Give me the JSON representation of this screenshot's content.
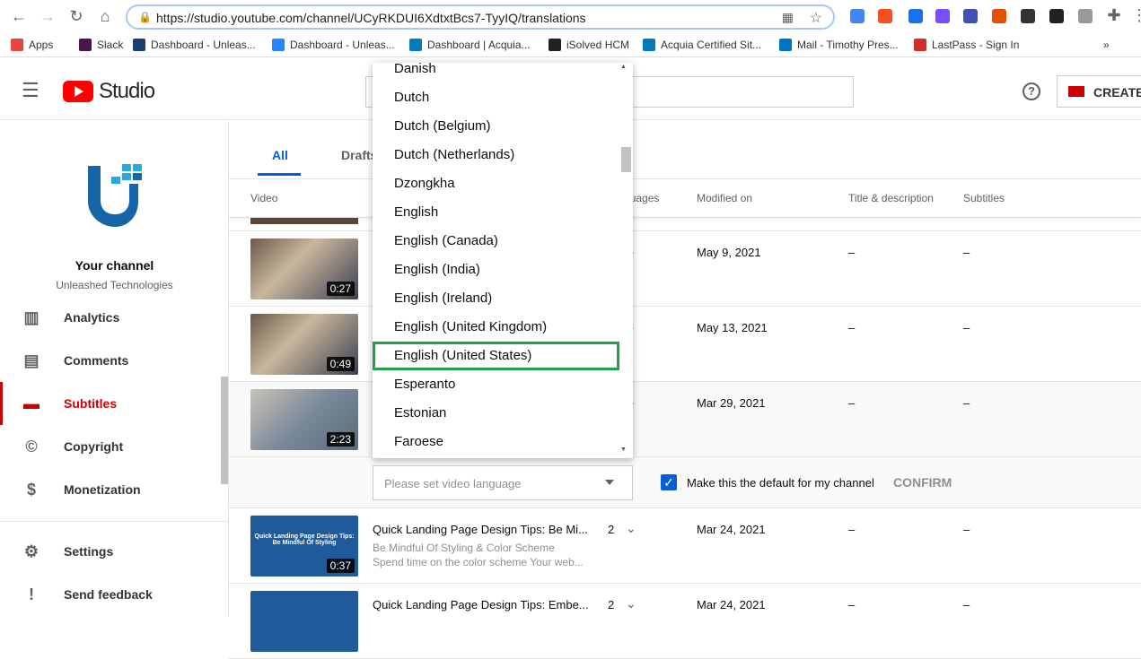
{
  "browser": {
    "url": "https://studio.youtube.com/channel/UCyRKDUI6XdtxtBcs7-TyyIQ/translations",
    "bookmarks": [
      {
        "label": "Apps",
        "color": "#e8453c"
      },
      {
        "label": "Slack",
        "color": "#4a154b"
      },
      {
        "label": "Dashboard - Unleas...",
        "color": "#1b3e6f"
      },
      {
        "label": "Dashboard - Unleas...",
        "color": "#2684ff"
      },
      {
        "label": "Dashboard | Acquia...",
        "color": "#0678be"
      },
      {
        "label": "iSolved HCM",
        "color": "#222"
      },
      {
        "label": "Acquia Certified Sit...",
        "color": "#0678be"
      },
      {
        "label": "Mail - Timothy Pres...",
        "color": "#0072c6"
      },
      {
        "label": "LastPass - Sign In",
        "color": "#d32d27"
      }
    ],
    "more": "»"
  },
  "header": {
    "logo": "Studio",
    "create": "CREATE",
    "help": "?"
  },
  "sidebar": {
    "channel_title": "Your channel",
    "channel_name": "Unleashed Technologies",
    "items": [
      {
        "label": "Analytics",
        "icon": "analytics-icon",
        "glyph": "▥"
      },
      {
        "label": "Comments",
        "icon": "comments-icon",
        "glyph": "▤"
      },
      {
        "label": "Subtitles",
        "icon": "subtitles-icon",
        "glyph": "▬"
      },
      {
        "label": "Copyright",
        "icon": "copyright-icon",
        "glyph": "©"
      },
      {
        "label": "Monetization",
        "icon": "dollar-icon",
        "glyph": "$"
      }
    ],
    "bottom": [
      {
        "label": "Settings",
        "icon": "gear-icon",
        "glyph": "⚙"
      },
      {
        "label": "Send feedback",
        "icon": "feedback-icon",
        "glyph": "!"
      }
    ]
  },
  "tabs": [
    {
      "label": "All"
    },
    {
      "label": "Drafts"
    }
  ],
  "columns": {
    "video": "Video",
    "languages": "Languages",
    "modified": "Modified on",
    "title_desc": "Title & description",
    "subtitles": "Subtitles"
  },
  "rows": [
    {
      "duration": "0:27",
      "modified": "May 9, 2021",
      "title_desc": "–",
      "subtitles": "–"
    },
    {
      "duration": "0:49",
      "modified": "May 13, 2021",
      "title_desc": "–",
      "subtitles": "–"
    },
    {
      "duration": "2:23",
      "modified": "Mar 29, 2021",
      "title_desc": "–",
      "subtitles": "–"
    },
    {
      "duration": "0:37",
      "title": "Quick Landing Page Design Tips: Be Mi...",
      "desc1": "Be Mindful Of Styling & Color Scheme",
      "desc2": "Spend time on the color scheme Your web...",
      "languages": "2",
      "modified": "Mar 24, 2021",
      "title_desc": "–",
      "subtitles": "–",
      "thumb_text": "Quick Landing Page Design Tips: Be Mindful Of Styling"
    },
    {
      "duration": "",
      "title": "Quick Landing Page Design Tips: Embe...",
      "languages": "2",
      "modified": "Mar 24, 2021",
      "title_desc": "–",
      "subtitles": "–"
    }
  ],
  "language_bar": {
    "placeholder": "Please set video language",
    "checkbox_label": "Make this the default for my channel",
    "checked": true,
    "confirm": "CONFIRM"
  },
  "dropdown": {
    "options": [
      "Danish",
      "Dutch",
      "Dutch (Belgium)",
      "Dutch (Netherlands)",
      "Dzongkha",
      "English",
      "English (Canada)",
      "English (India)",
      "English (Ireland)",
      "English (United Kingdom)",
      "English (United States)",
      "Esperanto",
      "Estonian",
      "Faroese"
    ],
    "highlighted": "English (United States)",
    "highlight_color": "#22a34a"
  }
}
